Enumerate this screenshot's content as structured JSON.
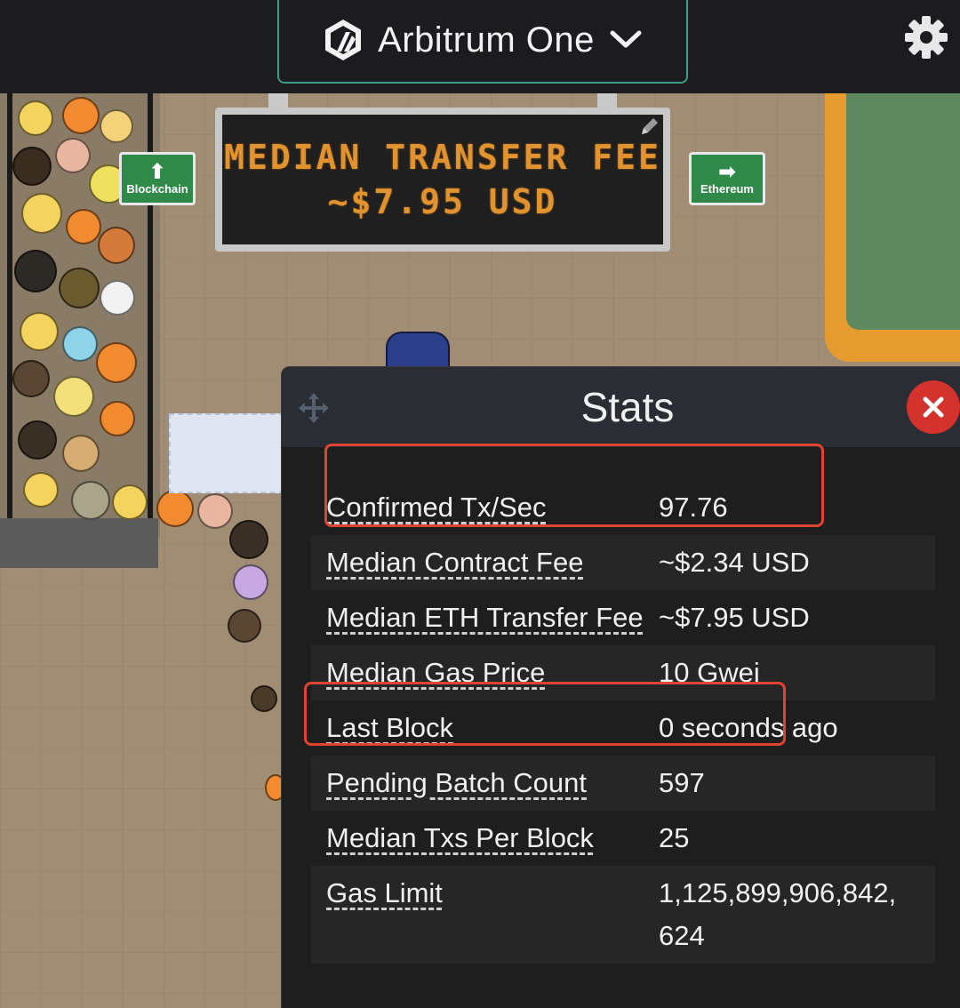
{
  "header": {
    "network": "Arbitrum One",
    "network_icon": "arbitrum-logo-icon",
    "dropdown_icon": "chevron-down-icon",
    "settings_icon": "gear-icon"
  },
  "scene": {
    "fee_sign": {
      "title": "MEDIAN TRANSFER FEE",
      "value": "~$7.95 USD"
    },
    "left_sign": "Blockchain",
    "right_sign": "Ethereum"
  },
  "stats": {
    "title": "Stats",
    "rows": [
      {
        "label": "Confirmed Tx/Sec",
        "value": "97.76"
      },
      {
        "label": "Median Contract Fee",
        "value": "~$2.34 USD"
      },
      {
        "label": "Median ETH Transfer Fee",
        "value": "~$7.95 USD"
      },
      {
        "label": "Median Gas Price",
        "value": "10 Gwei"
      },
      {
        "label": "Last Block",
        "value": "0 seconds ago"
      },
      {
        "label": "Pending Batch Count",
        "value": "597"
      },
      {
        "label": "Median Txs Per Block",
        "value": "25"
      },
      {
        "label": "Gas Limit",
        "value": "1,125,899,906,842, 624"
      }
    ]
  },
  "colors": {
    "accent_border": "#3f9c8a",
    "led_text": "#e0932f",
    "close_button": "#d3322d",
    "highlight_box": "#e0432f"
  }
}
